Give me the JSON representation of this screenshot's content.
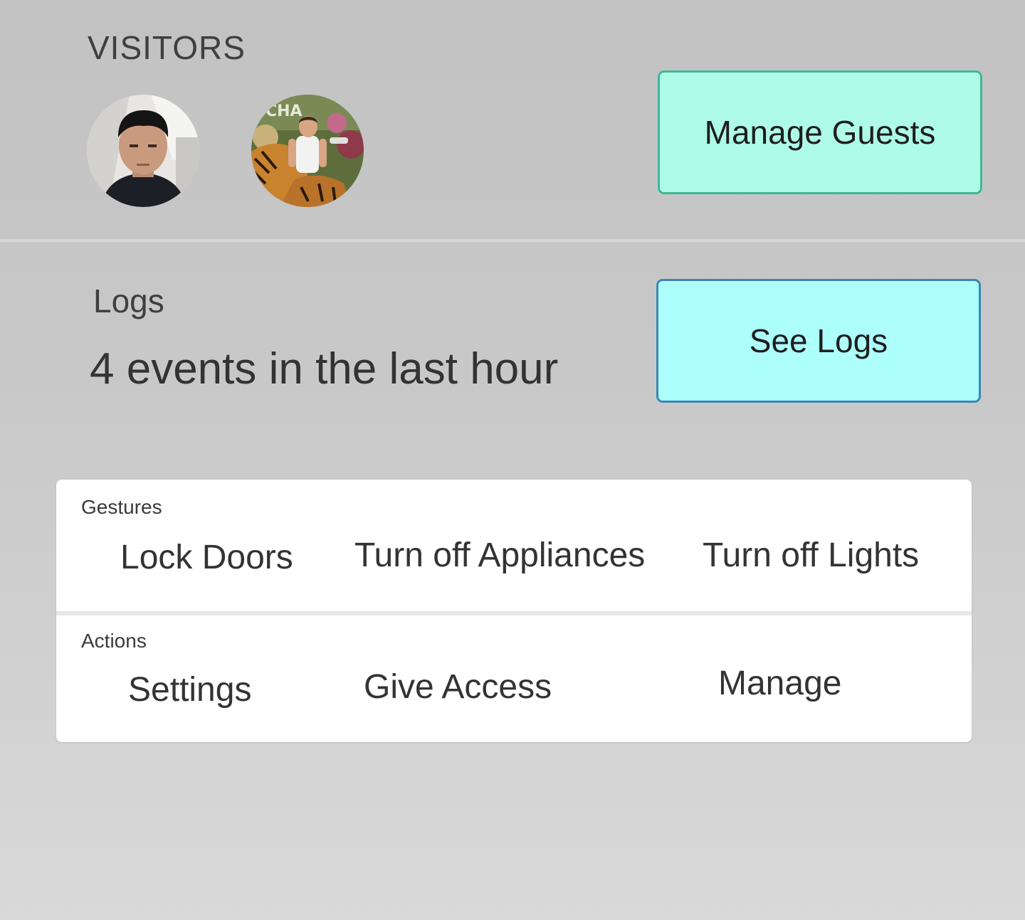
{
  "visitors": {
    "title": "VISITORS",
    "avatars": [
      {
        "name": "visitor-avatar-1"
      },
      {
        "name": "visitor-avatar-2"
      }
    ],
    "manage_button_label": "Manage Guests"
  },
  "logs": {
    "title": "Logs",
    "summary": "4 events in the last hour",
    "see_logs_label": "See Logs"
  },
  "card": {
    "gestures": {
      "label": "Gestures",
      "items": [
        "Lock Doors",
        "Turn off Appliances",
        "Turn off Lights"
      ]
    },
    "actions": {
      "label": "Actions",
      "items": [
        "Settings",
        "Give Access",
        "Manage"
      ]
    }
  },
  "colors": {
    "manage_guests_bg": "#aefce8",
    "manage_guests_border": "#3fb896",
    "see_logs_bg": "#adfffb",
    "see_logs_border": "#3b86b4"
  }
}
